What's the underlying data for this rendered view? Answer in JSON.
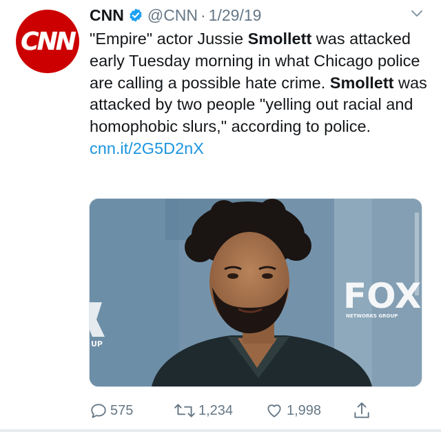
{
  "tweet": {
    "author_name": "CNN",
    "handle": "@CNN",
    "separator": "·",
    "date": "1/29/19",
    "avatar_text": "CNN",
    "text_1": "\"Empire\" actor Jussie ",
    "bold_1": "Smollett",
    "text_2": " was attacked early Tuesday morning in what Chicago police are calling a possible hate crime. ",
    "bold_2": "Smollett",
    "text_3": " was attacked by two people \"yelling out racial and homophobic slurs,\" according to police.",
    "link": "cnn.it/2G5D2nX",
    "media": {
      "backdrop_logo": "FOX",
      "backdrop_sub": "NETWORKS GROUP",
      "backdrop_fragment": "UP"
    }
  },
  "actions": {
    "replies": "575",
    "retweets": "1,234",
    "likes": "1,998"
  },
  "colors": {
    "brand_red": "#cc0000",
    "verified_blue": "#1da1f2",
    "link_blue": "#1b95e0",
    "muted_gray": "#657786"
  },
  "icons": [
    "verified-icon",
    "chevron-down-icon",
    "reply-icon",
    "retweet-icon",
    "like-icon",
    "share-icon"
  ]
}
